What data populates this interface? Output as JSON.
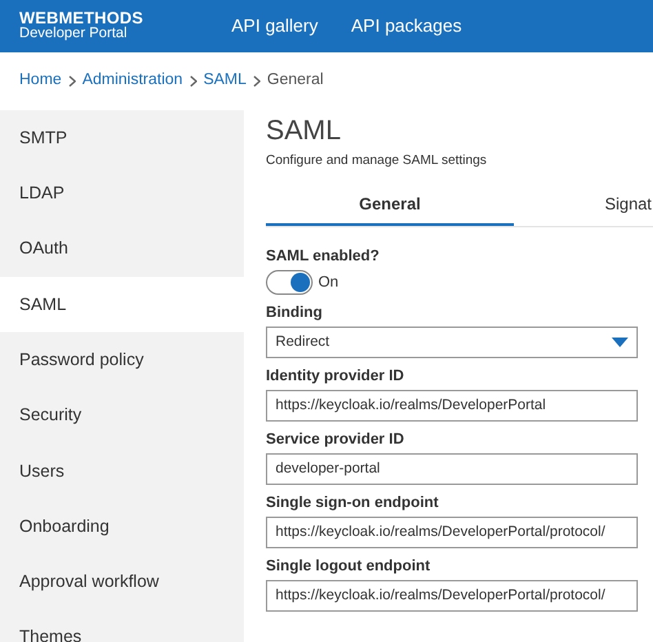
{
  "header": {
    "logo_title": "WEBMETHODS",
    "logo_subtitle": "Developer Portal",
    "nav": [
      "API gallery",
      "API packages"
    ]
  },
  "breadcrumb": [
    {
      "label": "Home",
      "link": true
    },
    {
      "label": "Administration",
      "link": true
    },
    {
      "label": "SAML",
      "link": true
    },
    {
      "label": "General",
      "link": false
    }
  ],
  "sidebar": {
    "items": [
      {
        "label": "SMTP",
        "selected": false
      },
      {
        "label": "LDAP",
        "selected": false
      },
      {
        "label": "OAuth",
        "selected": false
      },
      {
        "label": "SAML",
        "selected": true
      },
      {
        "label": "Password policy",
        "selected": false
      },
      {
        "label": "Security",
        "selected": false
      },
      {
        "label": "Users",
        "selected": false
      },
      {
        "label": "Onboarding",
        "selected": false
      },
      {
        "label": "Approval workflow",
        "selected": false
      },
      {
        "label": "Themes",
        "selected": false
      }
    ]
  },
  "content": {
    "title": "SAML",
    "subtitle": "Configure and manage SAML settings",
    "tabs": [
      {
        "label": "General",
        "selected": true
      },
      {
        "label": "Signat",
        "selected": false
      }
    ],
    "fields": [
      {
        "kind": "toggle",
        "label": "SAML enabled?",
        "on": true,
        "state_text": "On"
      },
      {
        "kind": "select",
        "label": "Binding",
        "value": "Redirect"
      },
      {
        "kind": "text",
        "label": "Identity provider ID",
        "value": "https://keycloak.io/realms/DeveloperPortal"
      },
      {
        "kind": "text",
        "label": "Service provider ID",
        "value": "developer-portal"
      },
      {
        "kind": "text",
        "label": "Single sign-on endpoint",
        "value": "https://keycloak.io/realms/DeveloperPortal/protocol/"
      },
      {
        "kind": "text",
        "label": "Single logout endpoint",
        "value": "https://keycloak.io/realms/DeveloperPortal/protocol/"
      }
    ]
  }
}
